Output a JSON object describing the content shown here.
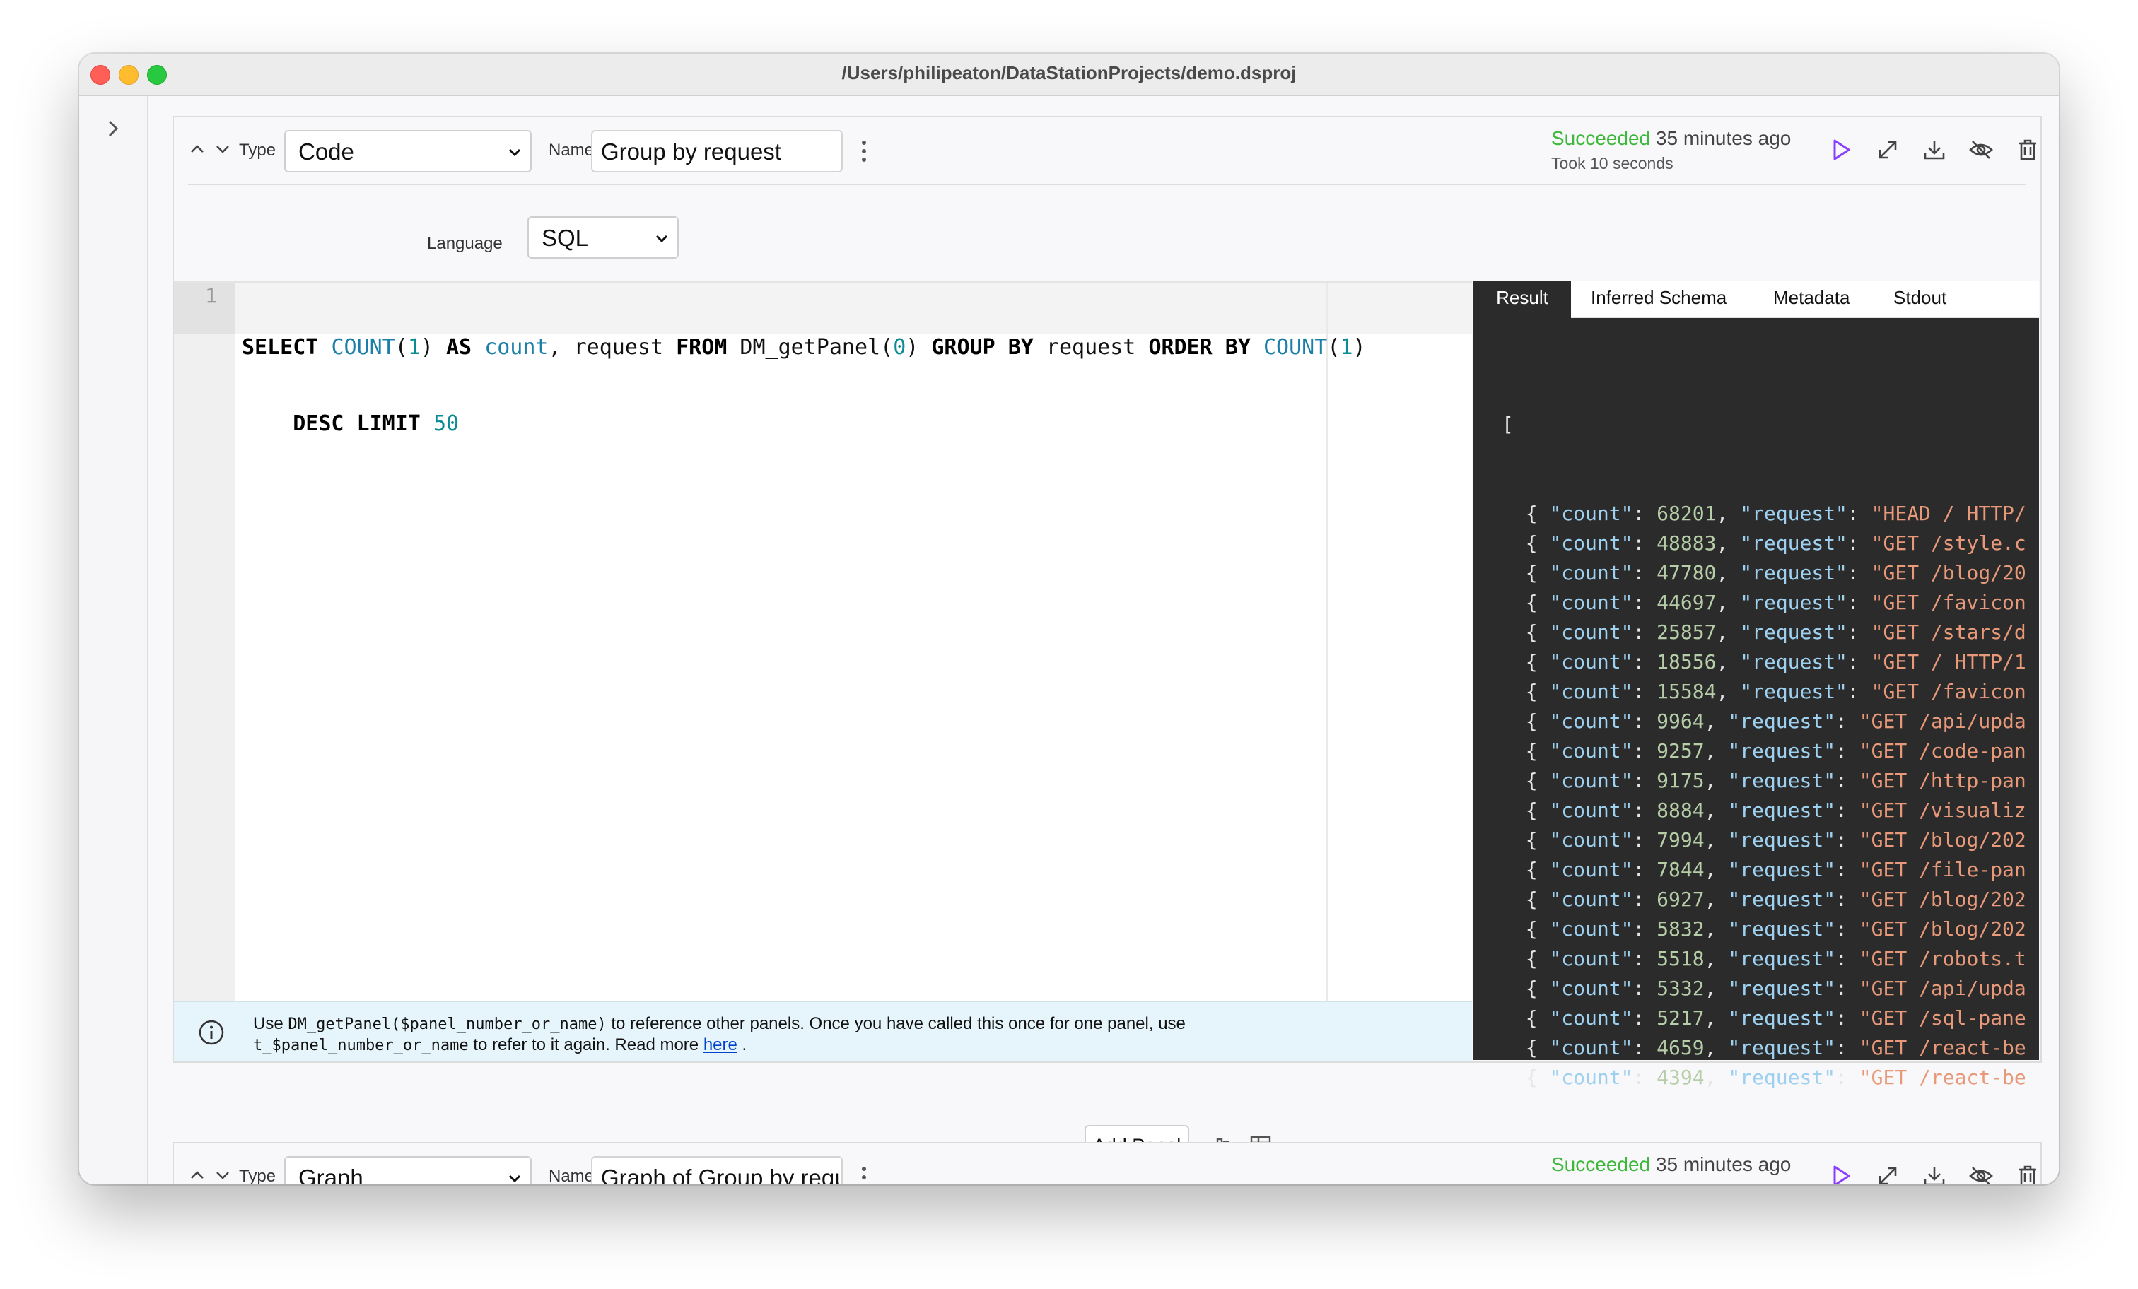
{
  "window": {
    "title": "/Users/philipeaton/DataStationProjects/demo.dsproj"
  },
  "colors": {
    "success": "#3db83b",
    "run": "#8a3ffc",
    "accent": "#0c8b95"
  },
  "panel1": {
    "type_label": "Type",
    "type_value": "Code",
    "name_label": "Name",
    "name_value": "Group by request",
    "status_ok": "Succeeded",
    "status_time": " 35 minutes ago",
    "took": "Took 10 seconds",
    "language_label": "Language",
    "language_value": "SQL",
    "editor": {
      "line_number": "1",
      "code_line1": [
        {
          "t": "SELECT",
          "c": "kw"
        },
        {
          "t": " ",
          "c": ""
        },
        {
          "t": "COUNT",
          "c": "fn"
        },
        {
          "t": "(",
          "c": ""
        },
        {
          "t": "1",
          "c": "num"
        },
        {
          "t": ") ",
          "c": ""
        },
        {
          "t": "AS",
          "c": "kw"
        },
        {
          "t": " ",
          "c": ""
        },
        {
          "t": "count",
          "c": "fn"
        },
        {
          "t": ", request ",
          "c": ""
        },
        {
          "t": "FROM",
          "c": "kw"
        },
        {
          "t": " DM_getPanel(",
          "c": ""
        },
        {
          "t": "0",
          "c": "num"
        },
        {
          "t": ") ",
          "c": ""
        },
        {
          "t": "GROUP BY",
          "c": "kw"
        },
        {
          "t": " request ",
          "c": ""
        },
        {
          "t": "ORDER BY",
          "c": "kw"
        },
        {
          "t": " ",
          "c": ""
        },
        {
          "t": "COUNT",
          "c": "fn"
        },
        {
          "t": "(",
          "c": ""
        },
        {
          "t": "1",
          "c": "num"
        },
        {
          "t": ")",
          "c": ""
        }
      ],
      "code_line2": [
        {
          "t": "    ",
          "c": ""
        },
        {
          "t": "DESC LIMIT",
          "c": "kw"
        },
        {
          "t": " ",
          "c": ""
        },
        {
          "t": "50",
          "c": "num"
        }
      ]
    },
    "help": {
      "p1": "Use ",
      "code1": "DM_getPanel($panel_number_or_name)",
      "p2": " to reference other panels. Once you have called this once for one panel, use",
      "code2": "t_$panel_number_or_name",
      "p3": " to refer to it again. Read more ",
      "link": "here",
      "p4": " ."
    },
    "result_tabs": [
      "Result",
      "Inferred Schema",
      "Metadata",
      "Stdout"
    ],
    "result": {
      "open": "[",
      "close": "]",
      "ellipsis": "...",
      "rows": [
        {
          "count": "68201",
          "request": "\"HEAD / HTTP/"
        },
        {
          "count": "48883",
          "request": "\"GET /style.c"
        },
        {
          "count": "47780",
          "request": "\"GET /blog/20"
        },
        {
          "count": "44697",
          "request": "\"GET /favicon"
        },
        {
          "count": "25857",
          "request": "\"GET /stars/d"
        },
        {
          "count": "18556",
          "request": "\"GET / HTTP/1"
        },
        {
          "count": "15584",
          "request": "\"GET /favicon"
        },
        {
          "count": "9964",
          "request": "\"GET /api/upda"
        },
        {
          "count": "9257",
          "request": "\"GET /code-pan"
        },
        {
          "count": "9175",
          "request": "\"GET /http-pan"
        },
        {
          "count": "8884",
          "request": "\"GET /visualiz"
        },
        {
          "count": "7994",
          "request": "\"GET /blog/202"
        },
        {
          "count": "7844",
          "request": "\"GET /file-pan"
        },
        {
          "count": "6927",
          "request": "\"GET /blog/202"
        },
        {
          "count": "5832",
          "request": "\"GET /blog/202"
        },
        {
          "count": "5518",
          "request": "\"GET /robots.t"
        },
        {
          "count": "5332",
          "request": "\"GET /api/upda"
        },
        {
          "count": "5217",
          "request": "\"GET /sql-pane"
        },
        {
          "count": "4659",
          "request": "\"GET /react-be"
        },
        {
          "count": "4394",
          "request": "\"GET /react-be"
        }
      ]
    }
  },
  "add_panel": {
    "label": "Add Panel"
  },
  "panel2": {
    "type_label": "Type",
    "type_value": "Graph",
    "name_label": "Name",
    "name_value": "Graph of  Group by request",
    "status_ok": "Succeeded",
    "status_time": " 35 minutes ago"
  }
}
